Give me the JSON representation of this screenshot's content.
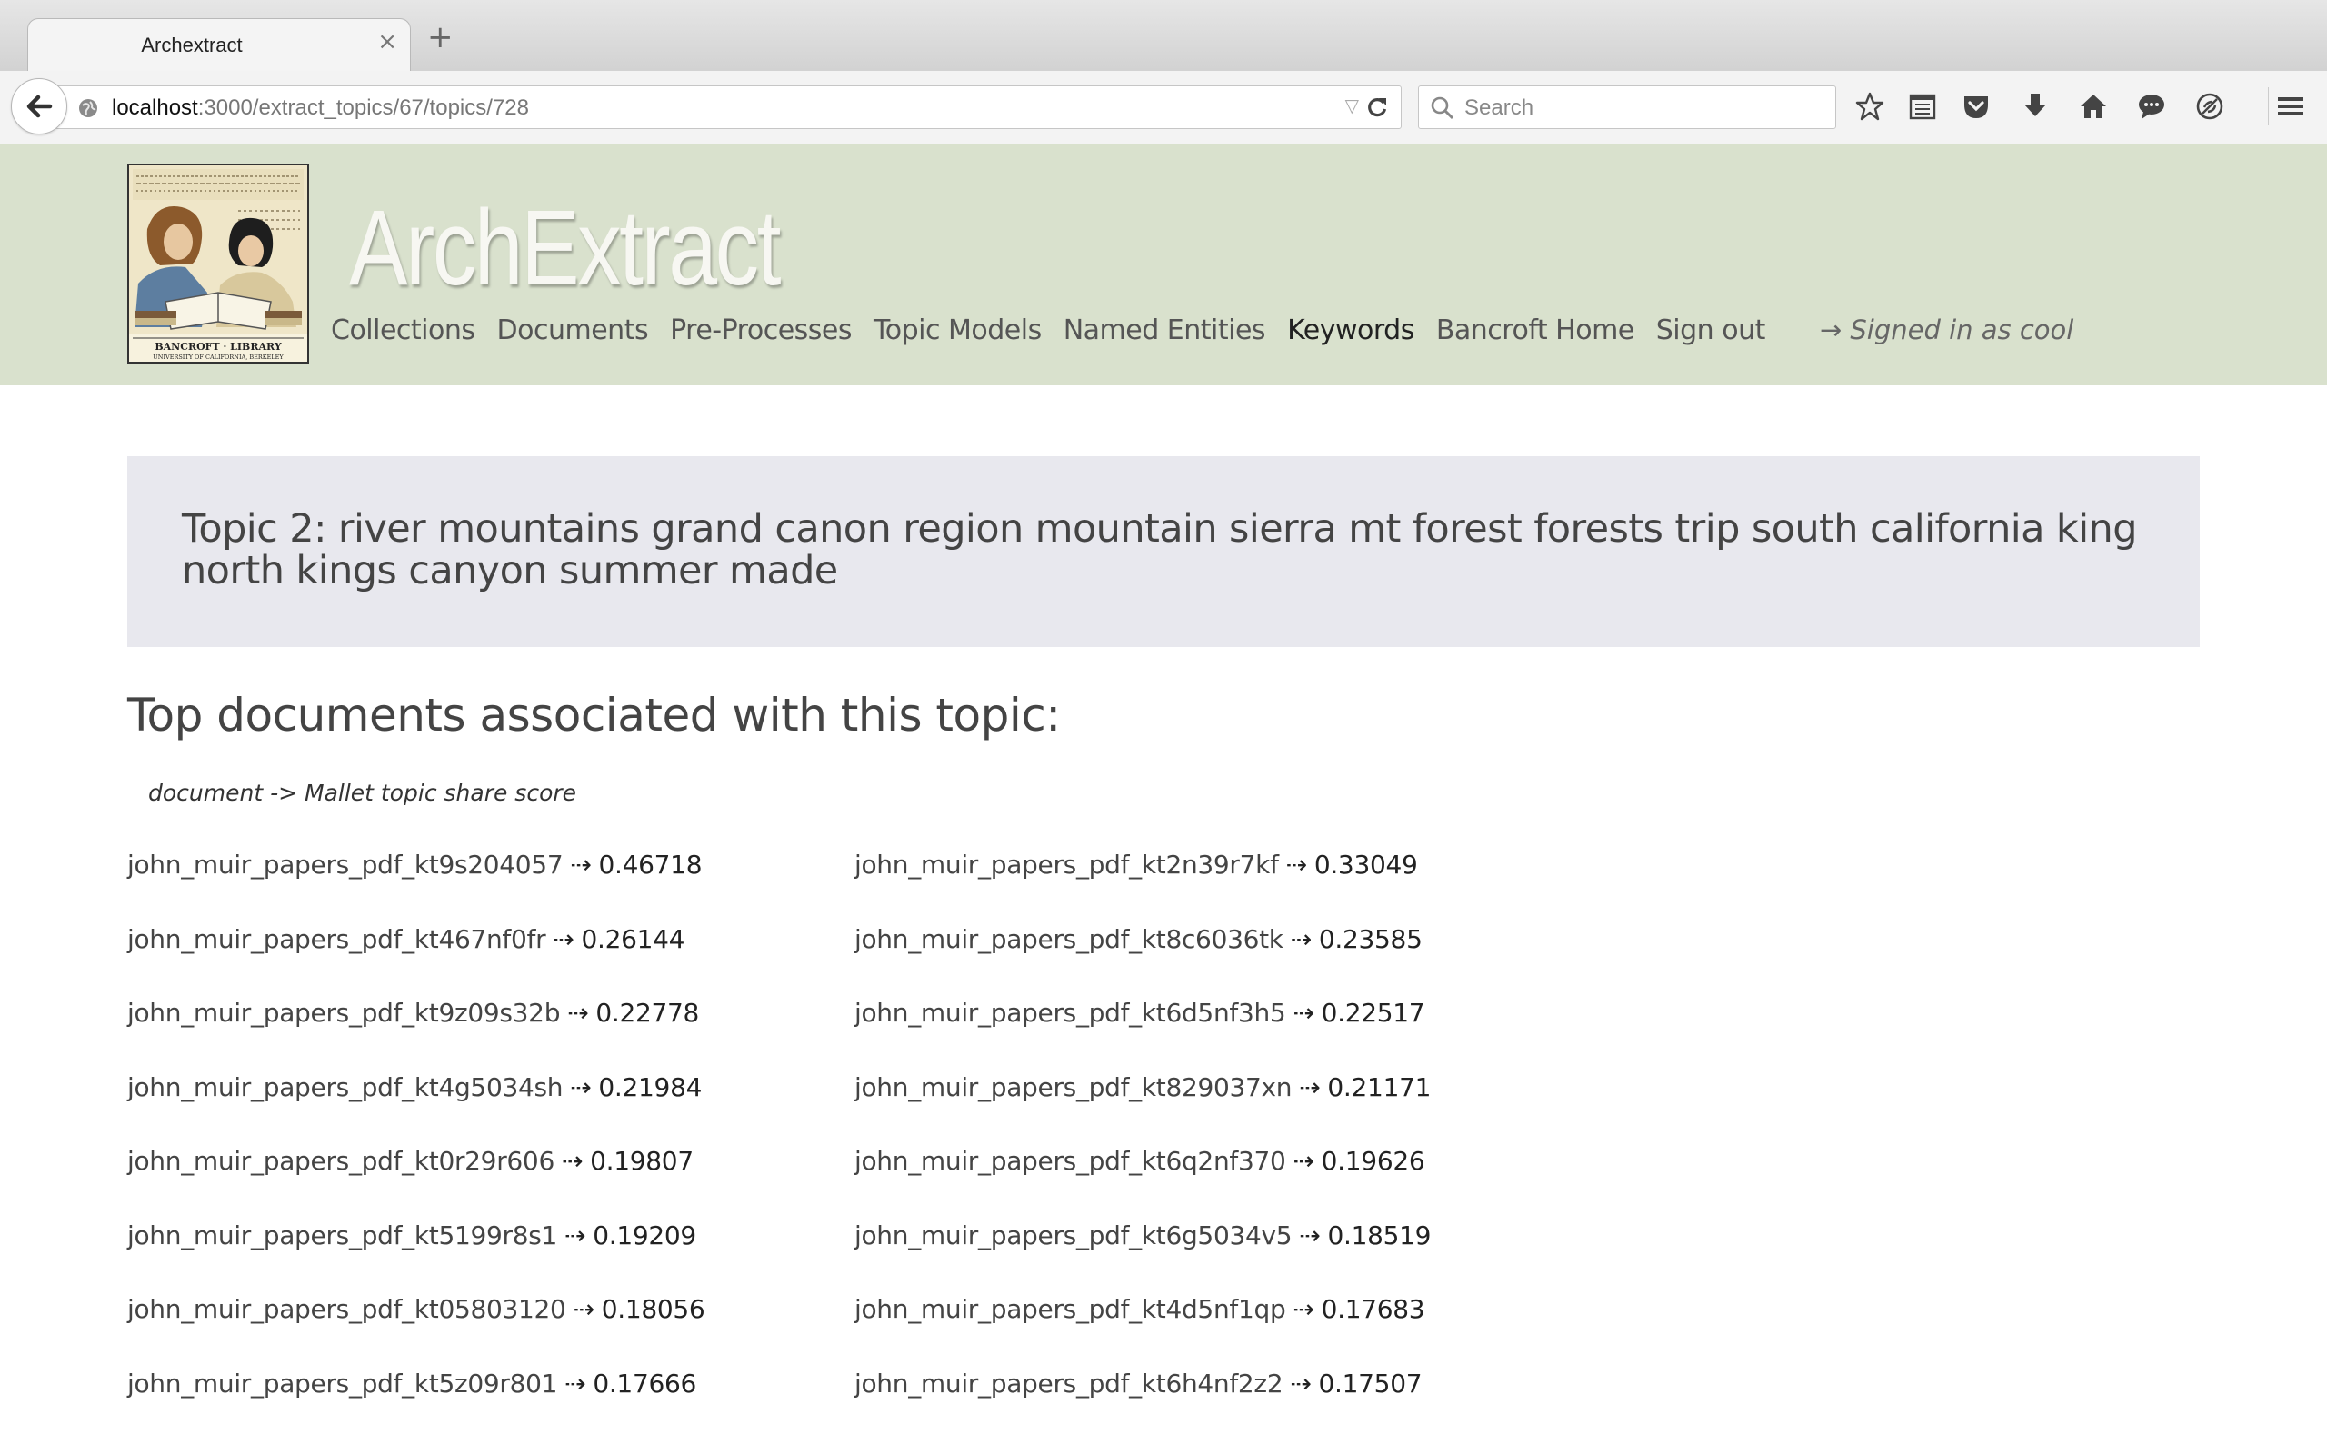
{
  "browser": {
    "tab_title": "Archextract",
    "tab_close": "×",
    "new_tab": "+",
    "url_host": "localhost",
    "url_path": ":3000/extract_topics/67/topics/728",
    "search_placeholder": "Search",
    "toolbar_icons": [
      "star-icon",
      "reading-list-icon",
      "pocket-icon",
      "download-icon",
      "home-icon",
      "chat-icon",
      "extension-icon",
      "menu-icon"
    ]
  },
  "header": {
    "brand": "ArchExtract",
    "logo_alt": "BANCROFT · LIBRARY · UNIVERSITY OF CALIFORNIA, BERKELEY",
    "nav": [
      {
        "label": "Collections",
        "active": false
      },
      {
        "label": "Documents",
        "active": false
      },
      {
        "label": "Pre-Processes",
        "active": false
      },
      {
        "label": "Topic Models",
        "active": false
      },
      {
        "label": "Named Entities",
        "active": false
      },
      {
        "label": "Keywords",
        "active": true
      },
      {
        "label": "Bancroft Home",
        "active": false
      },
      {
        "label": "Sign out",
        "active": false
      }
    ],
    "signed_in": "→ Signed in as cool"
  },
  "main": {
    "topic_title": "Topic 2: river mountains grand canon region mountain sierra mt forest forests trip south california king north kings canyon summer made",
    "section_heading": "Top documents associated with this topic:",
    "legend": "document -> Mallet topic share score",
    "arrow": "⇢",
    "documents": [
      {
        "name": "john_muir_papers_pdf_kt9s204057",
        "score": "0.46718"
      },
      {
        "name": "john_muir_papers_pdf_kt2n39r7kf",
        "score": "0.33049"
      },
      {
        "name": "john_muir_papers_pdf_kt467nf0fr",
        "score": "0.26144"
      },
      {
        "name": "john_muir_papers_pdf_kt8c6036tk",
        "score": "0.23585"
      },
      {
        "name": "john_muir_papers_pdf_kt9z09s32b",
        "score": "0.22778"
      },
      {
        "name": "john_muir_papers_pdf_kt6d5nf3h5",
        "score": "0.22517"
      },
      {
        "name": "john_muir_papers_pdf_kt4g5034sh",
        "score": "0.21984"
      },
      {
        "name": "john_muir_papers_pdf_kt829037xn",
        "score": "0.21171"
      },
      {
        "name": "john_muir_papers_pdf_kt0r29r606",
        "score": "0.19807"
      },
      {
        "name": "john_muir_papers_pdf_kt6q2nf370",
        "score": "0.19626"
      },
      {
        "name": "john_muir_papers_pdf_kt5199r8s1",
        "score": "0.19209"
      },
      {
        "name": "john_muir_papers_pdf_kt6g5034v5",
        "score": "0.18519"
      },
      {
        "name": "john_muir_papers_pdf_kt05803120",
        "score": "0.18056"
      },
      {
        "name": "john_muir_papers_pdf_kt4d5nf1qp",
        "score": "0.17683"
      },
      {
        "name": "john_muir_papers_pdf_kt5z09r801",
        "score": "0.17666"
      },
      {
        "name": "john_muir_papers_pdf_kt6h4nf2z2",
        "score": "0.17507"
      }
    ]
  }
}
